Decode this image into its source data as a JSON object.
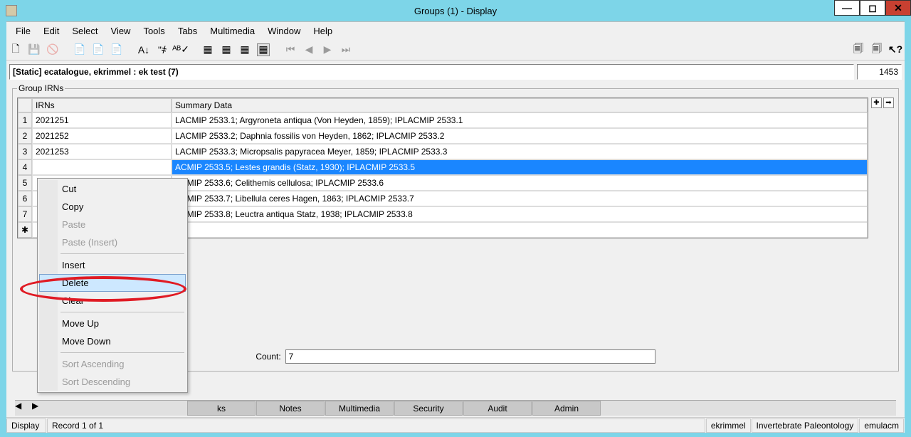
{
  "window": {
    "title": "Groups (1) - Display"
  },
  "menus": [
    "File",
    "Edit",
    "Select",
    "View",
    "Tools",
    "Tabs",
    "Multimedia",
    "Window",
    "Help"
  ],
  "infobar": {
    "text": "[Static] ecatalogue, ekrimmel : ek test (7)",
    "right": "1453"
  },
  "group_legend": "Group IRNs",
  "headers": {
    "irn": "IRNs",
    "summary": "Summary Data"
  },
  "rows": [
    {
      "n": "1",
      "irn": "2021251",
      "sum": "LACMIP 2533.1; Argyroneta antiqua (Von Heyden, 1859); IPLACMIP 2533.1"
    },
    {
      "n": "2",
      "irn": "2021252",
      "sum": "LACMIP 2533.2; Daphnia fossilis von Heyden, 1862; IPLACMIP 2533.2"
    },
    {
      "n": "3",
      "irn": "2021253",
      "sum": "LACMIP 2533.3; Micropsalis papyracea Meyer, 1859; IPLACMIP 2533.3"
    },
    {
      "n": "4",
      "irn": "",
      "sum": "ACMIP 2533.5; Lestes grandis (Statz, 1930); IPLACMIP 2533.5",
      "sel": true
    },
    {
      "n": "5",
      "irn": "",
      "sum": "ACMIP 2533.6; Celithemis cellulosa; IPLACMIP 2533.6"
    },
    {
      "n": "6",
      "irn": "",
      "sum": "ACMIP 2533.7; Libellula ceres Hagen, 1863; IPLACMIP 2533.7"
    },
    {
      "n": "7",
      "irn": "",
      "sum": "ACMIP 2533.8; Leuctra antiqua Statz, 1938; IPLACMIP 2533.8"
    },
    {
      "n": "✱",
      "irn": "",
      "sum": ""
    }
  ],
  "count": {
    "label": "Count:",
    "value": "7"
  },
  "context_menu": {
    "items": [
      {
        "label": "Cut"
      },
      {
        "label": "Copy"
      },
      {
        "label": "Paste",
        "disabled": true
      },
      {
        "label": "Paste (Insert)",
        "disabled": true
      },
      {
        "sep": true
      },
      {
        "label": "Insert"
      },
      {
        "label": "Delete",
        "hover": true
      },
      {
        "label": "Clear"
      },
      {
        "sep": true
      },
      {
        "label": "Move Up"
      },
      {
        "label": "Move Down"
      },
      {
        "sep": true
      },
      {
        "label": "Sort Ascending",
        "disabled": true
      },
      {
        "label": "Sort Descending",
        "disabled": true
      }
    ]
  },
  "tabs": [
    "",
    "",
    "ks",
    "Notes",
    "Multimedia",
    "Security",
    "Audit",
    "Admin"
  ],
  "status": {
    "left1": "Display",
    "left2": "Record 1 of 1",
    "right": [
      "ekrimmel",
      "Invertebrate Paleontology",
      "emulacm"
    ]
  }
}
